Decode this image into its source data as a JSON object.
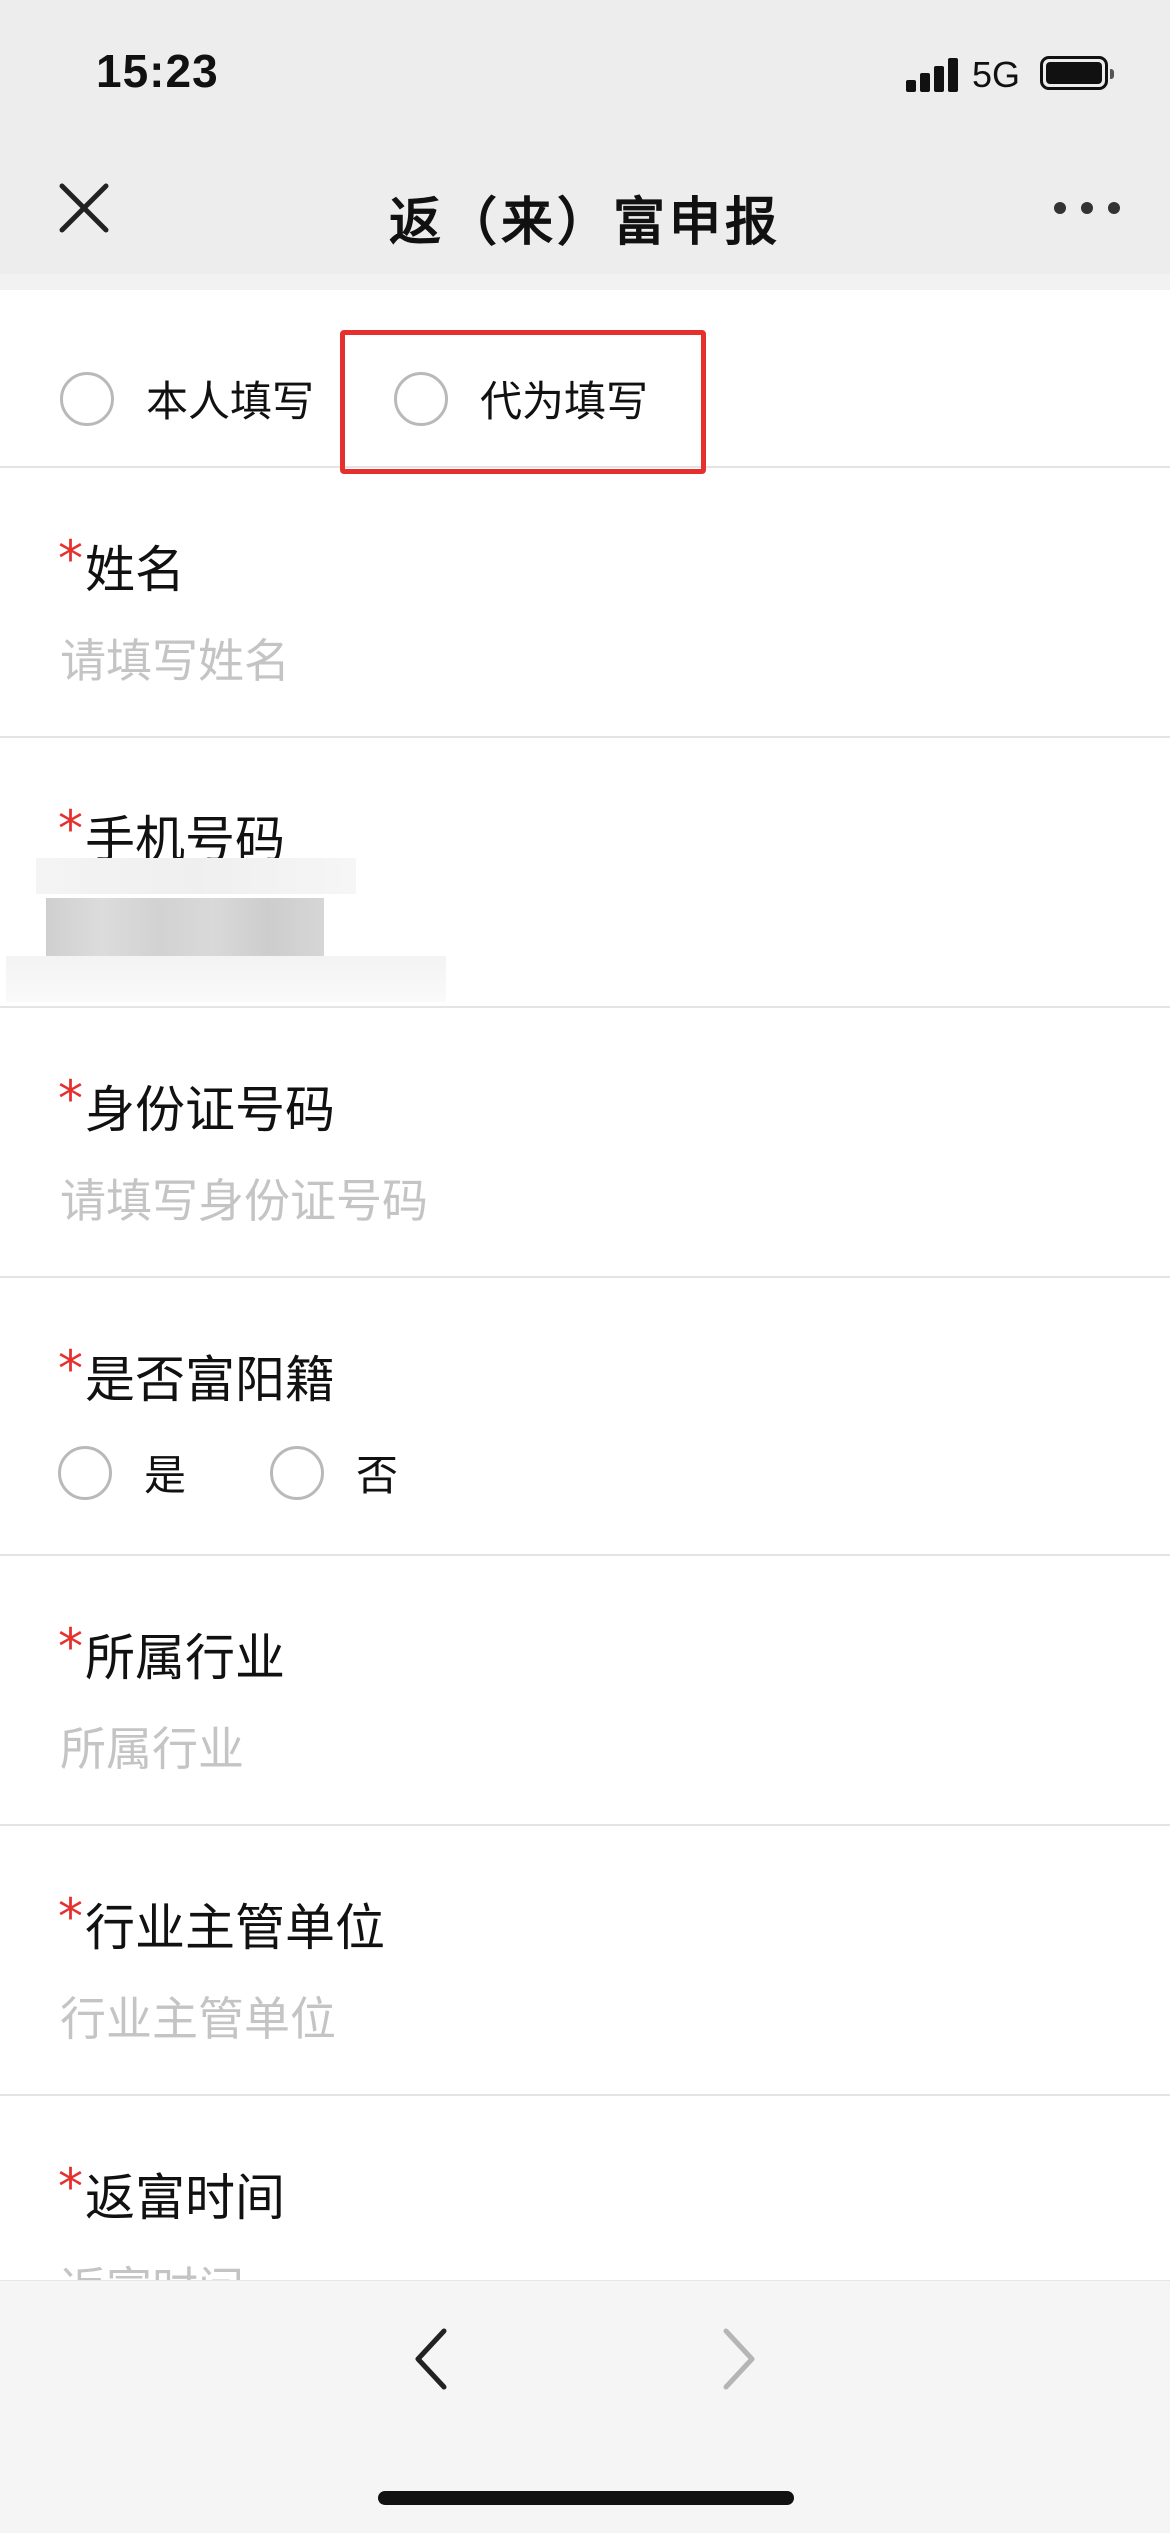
{
  "status_bar": {
    "time": "15:23",
    "network": "5G"
  },
  "nav": {
    "title": "返（来）富申报",
    "close_icon": "close-icon",
    "more_icon": "more-icon"
  },
  "fill_mode": {
    "options": [
      {
        "label": "本人填写",
        "selected": false
      },
      {
        "label": "代为填写",
        "selected": false,
        "highlighted": true
      }
    ],
    "highlight_color": "#e5302e"
  },
  "form": {
    "required_mark": "*",
    "fields": [
      {
        "label": "姓名",
        "placeholder": "请填写姓名",
        "value": ""
      },
      {
        "label": "手机号码",
        "value_redacted": true
      },
      {
        "label": "身份证号码",
        "placeholder": "请填写身份证号码",
        "value": ""
      },
      {
        "label": "是否富阳籍",
        "options": [
          {
            "label": "是",
            "selected": false
          },
          {
            "label": "否",
            "selected": false
          }
        ]
      },
      {
        "label": "所属行业",
        "placeholder": "所属行业",
        "value": ""
      },
      {
        "label": "行业主管单位",
        "placeholder": "行业主管单位",
        "value": ""
      },
      {
        "label": "返富时间",
        "placeholder": "返富时间",
        "value": ""
      }
    ]
  },
  "bottom_nav": {
    "back_icon": "chevron-left-icon",
    "forward_icon": "chevron-right-icon",
    "forward_enabled": false
  },
  "colors": {
    "accent_red": "#e5302e",
    "nav_background": "#ededed",
    "placeholder": "#c4c4c4"
  }
}
